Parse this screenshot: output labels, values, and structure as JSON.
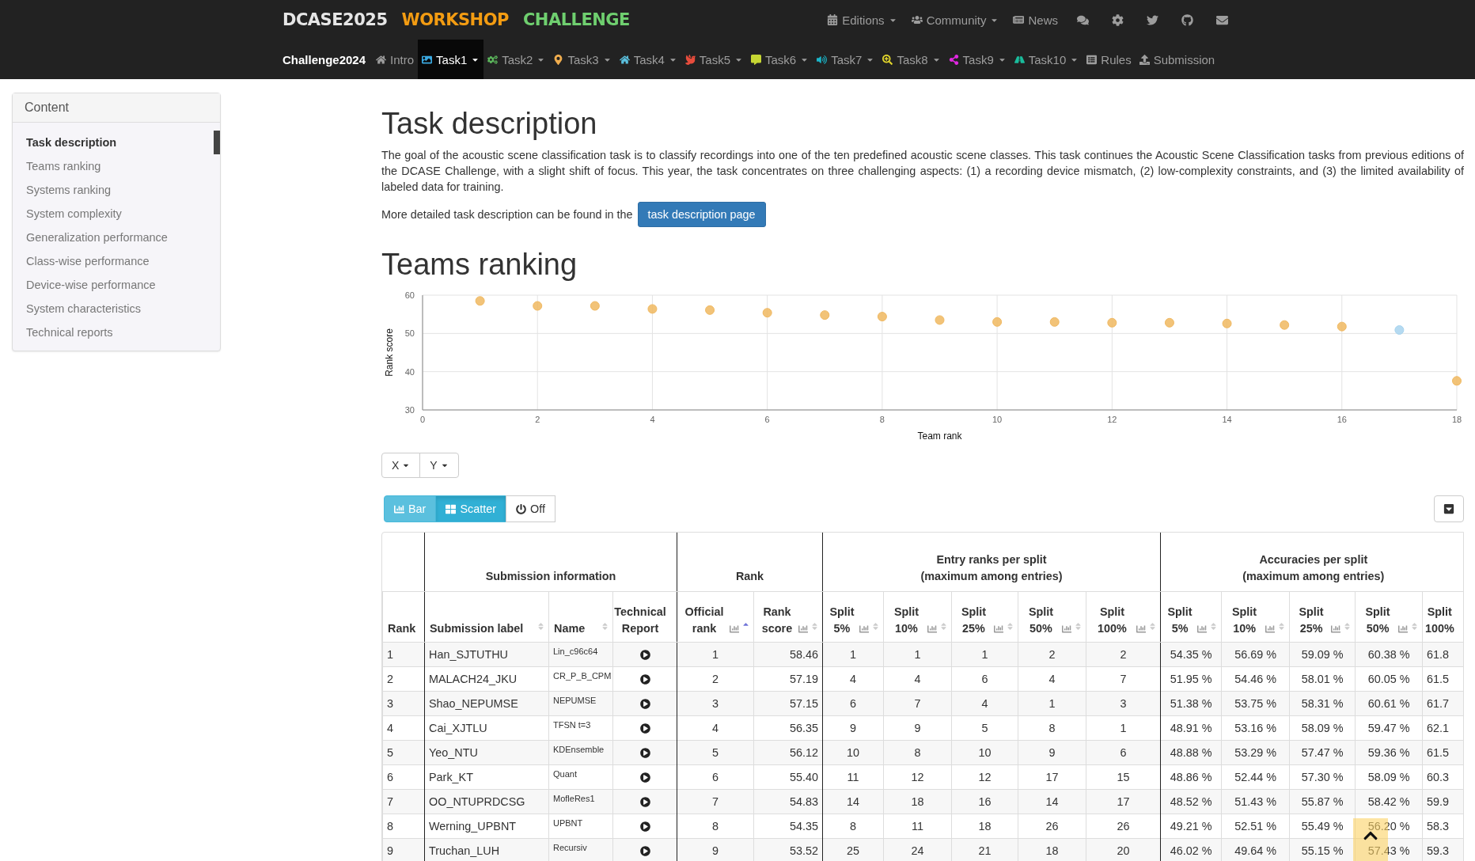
{
  "logo": [
    {
      "text": "DCASE2025",
      "color": "#e6e6e6"
    },
    {
      "text": "WORKSHOP",
      "color": "#f39c12"
    },
    {
      "text": "CHALLENGE",
      "color": "#6fcf6f"
    }
  ],
  "top_nav": [
    {
      "label": "Editions",
      "dropdown": true
    },
    {
      "label": "Community",
      "dropdown": true
    },
    {
      "label": "News",
      "dropdown": false
    }
  ],
  "brand": "Challenge2024",
  "sub_nav": [
    {
      "label": "Intro",
      "selected": false,
      "dropdown": false
    },
    {
      "label": "Task1",
      "selected": true,
      "dropdown": true
    },
    {
      "label": "Task2",
      "selected": false,
      "dropdown": true
    },
    {
      "label": "Task3",
      "selected": false,
      "dropdown": true
    },
    {
      "label": "Task4",
      "selected": false,
      "dropdown": true
    },
    {
      "label": "Task5",
      "selected": false,
      "dropdown": true
    },
    {
      "label": "Task6",
      "selected": false,
      "dropdown": true
    },
    {
      "label": "Task7",
      "selected": false,
      "dropdown": true
    },
    {
      "label": "Task8",
      "selected": false,
      "dropdown": true
    },
    {
      "label": "Task9",
      "selected": false,
      "dropdown": true
    },
    {
      "label": "Task10",
      "selected": false,
      "dropdown": true
    },
    {
      "label": "Rules",
      "selected": false,
      "dropdown": false
    },
    {
      "label": "Submission",
      "selected": false,
      "dropdown": false
    }
  ],
  "sidebar": {
    "title": "Content",
    "items": [
      {
        "label": "Task description",
        "selected": true
      },
      {
        "label": "Teams ranking",
        "selected": false
      },
      {
        "label": "Systems ranking",
        "selected": false
      },
      {
        "label": "System complexity",
        "selected": false
      },
      {
        "label": "Generalization performance",
        "selected": false
      },
      {
        "label": "Class-wise performance",
        "selected": false
      },
      {
        "label": "Device-wise performance",
        "selected": false
      },
      {
        "label": "System characteristics",
        "selected": false
      },
      {
        "label": "Technical reports",
        "selected": false
      }
    ]
  },
  "main": {
    "title": "Task description",
    "paragraph": "The goal of the acoustic scene classification task is to classify recordings into one of the ten predefined acoustic scene classes. This task continues the Acoustic Scene Classification tasks from previous editions of the DCASE Challenge, with a slight shift of focus. This year, the task concentrates on three challenging aspects: (1) a recording device mismatch, (2) low-complexity constraints, and (3) the limited availability of labeled data for training.",
    "more_text": "More detailed task description can be found in the",
    "more_button": "task description page",
    "ranking_title": "Teams ranking",
    "chart_data": {
      "type": "scatter",
      "xlabel": "Team rank",
      "ylabel": "Rank score",
      "xlim": [
        0,
        18
      ],
      "ylim": [
        30,
        60
      ],
      "xticks": [
        0,
        2,
        4,
        6,
        8,
        10,
        12,
        14,
        16,
        18
      ],
      "yticks": [
        30,
        40,
        50,
        60
      ],
      "x": [
        1,
        2,
        3,
        4,
        5,
        6,
        7,
        8,
        9,
        10,
        11,
        12,
        13,
        14,
        15,
        16,
        17,
        18
      ],
      "grid": true,
      "series": [
        {
          "color": "#f0b860",
          "values": [
            58.5,
            57.2,
            57.2,
            56.4,
            56.1,
            55.4,
            54.8,
            54.4,
            53.5,
            53.0,
            53.0,
            52.8,
            52.8,
            52.6,
            52.2,
            51.8,
            null,
            37.6
          ]
        },
        {
          "color": "#a8d4ee",
          "values": [
            null,
            null,
            null,
            null,
            null,
            null,
            null,
            null,
            null,
            null,
            null,
            null,
            null,
            null,
            null,
            null,
            50.9,
            null
          ]
        }
      ]
    },
    "axis_buttons": [
      {
        "label": "X"
      },
      {
        "label": "Y"
      }
    ],
    "chart_modes": [
      {
        "label": "Bar",
        "kind": "bar",
        "selected": false
      },
      {
        "label": "Scatter",
        "kind": "scatter",
        "selected": true
      },
      {
        "label": "Off",
        "kind": "off",
        "selected": false
      }
    ],
    "table": {
      "groups": [
        {
          "title": "Submission information"
        },
        {
          "title": "Rank"
        },
        {
          "title": "Entry ranks per split",
          "note": "(maximum among entries)"
        },
        {
          "title": "Accuracies per split",
          "note": "(maximum among entries)"
        }
      ],
      "columns": [
        {
          "label": "Rank"
        },
        {
          "label": "Submission label",
          "sorted": false
        },
        {
          "label": "Name",
          "sorted": false
        },
        {
          "label": "Technical Report"
        },
        {
          "label": "Official rank",
          "sorted": true,
          "plot": true
        },
        {
          "label": "Rank score",
          "sorted": false,
          "plot": true
        },
        {
          "label": "Split 5%",
          "sorted": false,
          "plot": true
        },
        {
          "label": "Split 10%",
          "sorted": false,
          "plot": true
        },
        {
          "label": "Split 25%",
          "sorted": false,
          "plot": true
        },
        {
          "label": "Split 50%",
          "sorted": false,
          "plot": true
        },
        {
          "label": "Split 100%",
          "sorted": false,
          "plot": true
        },
        {
          "label": "Split 5%",
          "sorted": false,
          "plot": true
        },
        {
          "label": "Split 10%",
          "sorted": false,
          "plot": true
        },
        {
          "label": "Split 25%",
          "sorted": false,
          "plot": true
        },
        {
          "label": "Split 50%",
          "sorted": false,
          "plot": true
        },
        {
          "label": "Split 100%"
        }
      ],
      "rows": [
        {
          "rank": "1",
          "label": "Han_SJTUTHU",
          "name": "Lin_c96c64",
          "official": "1",
          "score": "58.46",
          "entry": [
            "1",
            "1",
            "1",
            "2",
            "2"
          ],
          "acc": [
            "54.35 %",
            "56.69 %",
            "59.09 %",
            "60.38 %",
            "61.8"
          ]
        },
        {
          "rank": "2",
          "label": "MALACH24_JKU",
          "name": "CR_P_B_CPM",
          "official": "2",
          "score": "57.19",
          "entry": [
            "4",
            "4",
            "6",
            "4",
            "7"
          ],
          "acc": [
            "51.95 %",
            "54.46 %",
            "58.01 %",
            "60.05 %",
            "61.5"
          ]
        },
        {
          "rank": "3",
          "label": "Shao_NEPUMSE",
          "name": "NEPUMSE",
          "official": "3",
          "score": "57.15",
          "entry": [
            "6",
            "7",
            "4",
            "1",
            "3"
          ],
          "acc": [
            "51.38 %",
            "53.75 %",
            "58.31 %",
            "60.61 %",
            "61.7"
          ]
        },
        {
          "rank": "4",
          "label": "Cai_XJTLU",
          "name": "TFSN t=3",
          "official": "4",
          "score": "56.35",
          "entry": [
            "9",
            "9",
            "5",
            "8",
            "1"
          ],
          "acc": [
            "48.91 %",
            "53.16 %",
            "58.09 %",
            "59.47 %",
            "62.1"
          ]
        },
        {
          "rank": "5",
          "label": "Yeo_NTU",
          "name": "KDEnsemble",
          "official": "5",
          "score": "56.12",
          "entry": [
            "10",
            "8",
            "10",
            "9",
            "6"
          ],
          "acc": [
            "48.88 %",
            "53.29 %",
            "57.47 %",
            "59.36 %",
            "61.5"
          ]
        },
        {
          "rank": "6",
          "label": "Park_KT",
          "name": "Quant",
          "official": "6",
          "score": "55.40",
          "entry": [
            "11",
            "12",
            "12",
            "17",
            "15"
          ],
          "acc": [
            "48.86 %",
            "52.44 %",
            "57.30 %",
            "58.09 %",
            "60.3"
          ]
        },
        {
          "rank": "7",
          "label": "OO_NTUPRDCSG",
          "name": "MofleRes1",
          "official": "7",
          "score": "54.83",
          "entry": [
            "14",
            "18",
            "16",
            "14",
            "17"
          ],
          "acc": [
            "48.52 %",
            "51.43 %",
            "55.87 %",
            "58.42 %",
            "59.9"
          ]
        },
        {
          "rank": "8",
          "label": "Werning_UPBNT",
          "name": "UPBNT",
          "official": "8",
          "score": "54.35",
          "entry": [
            "8",
            "11",
            "18",
            "26",
            "26"
          ],
          "acc": [
            "49.21 %",
            "52.51 %",
            "55.49 %",
            "56.20 %",
            "58.3"
          ]
        },
        {
          "rank": "9",
          "label": "Truchan_LUH",
          "name": "Recursiv",
          "official": "9",
          "score": "53.52",
          "entry": [
            "25",
            "24",
            "21",
            "18",
            "20"
          ],
          "acc": [
            "46.02 %",
            "49.64 %",
            "55.15 %",
            "57.43 %",
            "59.3"
          ]
        }
      ]
    }
  }
}
